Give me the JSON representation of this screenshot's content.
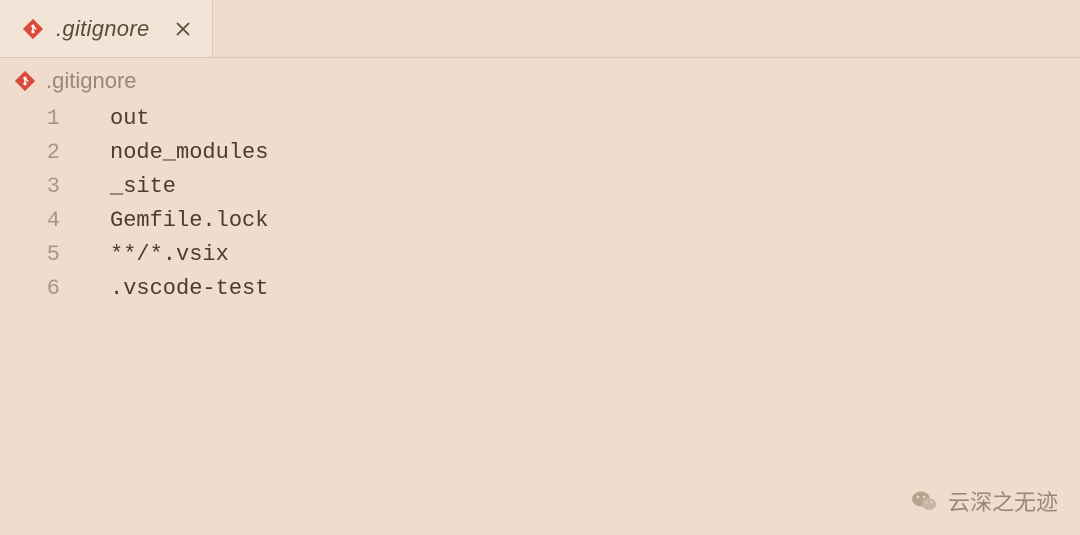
{
  "tab": {
    "title": ".gitignore",
    "icon": "git-icon"
  },
  "breadcrumb": {
    "text": ".gitignore",
    "icon": "git-icon"
  },
  "editor": {
    "lines": [
      {
        "number": "1",
        "content": "out"
      },
      {
        "number": "2",
        "content": "node_modules"
      },
      {
        "number": "3",
        "content": "_site"
      },
      {
        "number": "4",
        "content": "Gemfile.lock"
      },
      {
        "number": "5",
        "content": "**/*.vsix"
      },
      {
        "number": "6",
        "content": ".vscode-test"
      }
    ]
  },
  "watermark": {
    "text": "云深之无迹",
    "icon": "wechat-icon"
  }
}
